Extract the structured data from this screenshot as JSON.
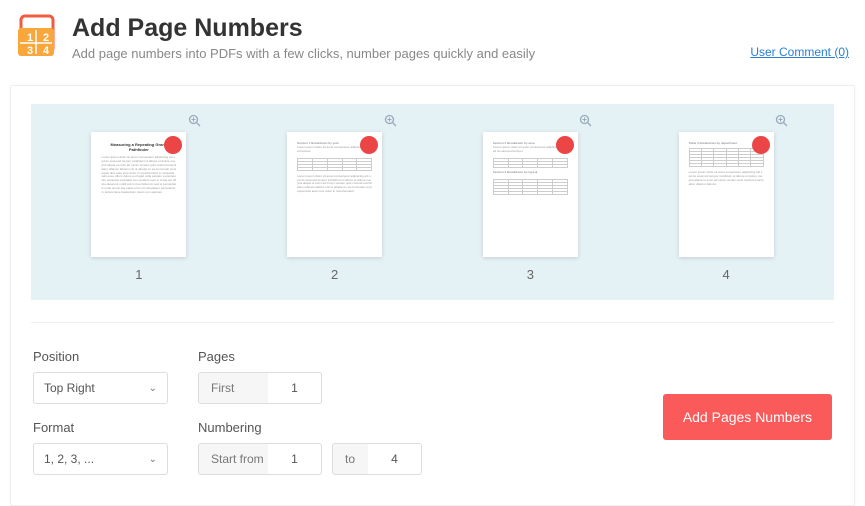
{
  "header": {
    "title": "Add Page Numbers",
    "subtitle": "Add page numbers into PDFs with a few clicks, number pages quickly and easily",
    "user_comment": "User Comment (0)"
  },
  "thumbs": {
    "labels": [
      "1",
      "2",
      "3",
      "4"
    ]
  },
  "form": {
    "position_label": "Position",
    "position_value": "Top  Right",
    "format_label": "Format",
    "format_value": "1, 2, 3, ...",
    "pages_label": "Pages",
    "pages_prefix": "First",
    "pages_value": "1",
    "numbering_label": "Numbering",
    "numbering_prefix": "Start from",
    "numbering_from": "1",
    "numbering_to_label": "to",
    "numbering_to": "4",
    "submit": "Add Pages Numbers"
  }
}
